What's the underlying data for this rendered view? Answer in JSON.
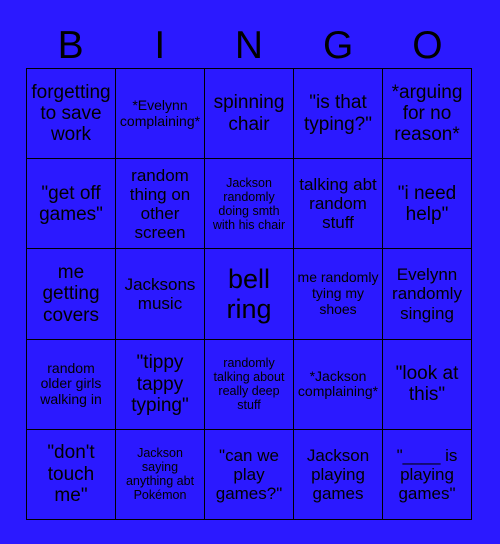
{
  "colors": {
    "background": "#2b19ff",
    "cell_background": "#2b19ff",
    "grid_line": "#000000",
    "text": "#000000"
  },
  "header": {
    "letters": [
      "B",
      "I",
      "N",
      "G",
      "O"
    ]
  },
  "grid": {
    "rows": 5,
    "columns": 5,
    "cells": [
      [
        {
          "text": "forgetting to save work",
          "size": "lg"
        },
        {
          "text": "*Evelynn complaining*",
          "size": "sm"
        },
        {
          "text": "spinning chair",
          "size": "lg"
        },
        {
          "text": "\"is that typing?\"",
          "size": "lg"
        },
        {
          "text": "*arguing for no reason*",
          "size": "lg"
        }
      ],
      [
        {
          "text": "\"get off games\"",
          "size": "lg"
        },
        {
          "text": "random thing on other screen",
          "size": "md"
        },
        {
          "text": "Jackson randomly doing smth with his chair",
          "size": "xs"
        },
        {
          "text": "talking abt random stuff",
          "size": "md"
        },
        {
          "text": "\"i need help\"",
          "size": "lg"
        }
      ],
      [
        {
          "text": "me getting covers",
          "size": "lg"
        },
        {
          "text": "Jacksons music",
          "size": "md"
        },
        {
          "text": "bell ring",
          "size": "xl"
        },
        {
          "text": "me randomly tying my shoes",
          "size": "sm"
        },
        {
          "text": "Evelynn randomly singing",
          "size": "md"
        }
      ],
      [
        {
          "text": "random older girls walking in",
          "size": "sm"
        },
        {
          "text": "\"tippy tappy typing\"",
          "size": "lg"
        },
        {
          "text": "randomly talking about really deep stuff",
          "size": "xs"
        },
        {
          "text": "*Jackson complaining*",
          "size": "sm"
        },
        {
          "text": "\"look at this\"",
          "size": "lg"
        }
      ],
      [
        {
          "text": "\"don't touch me\"",
          "size": "lg"
        },
        {
          "text": "Jackson saying anything abt Pokémon",
          "size": "xs"
        },
        {
          "text": "\"can we play games?\"",
          "size": "md"
        },
        {
          "text": "Jackson playing games",
          "size": "md"
        },
        {
          "text": "\"____ is playing games\"",
          "size": "md"
        }
      ]
    ]
  }
}
